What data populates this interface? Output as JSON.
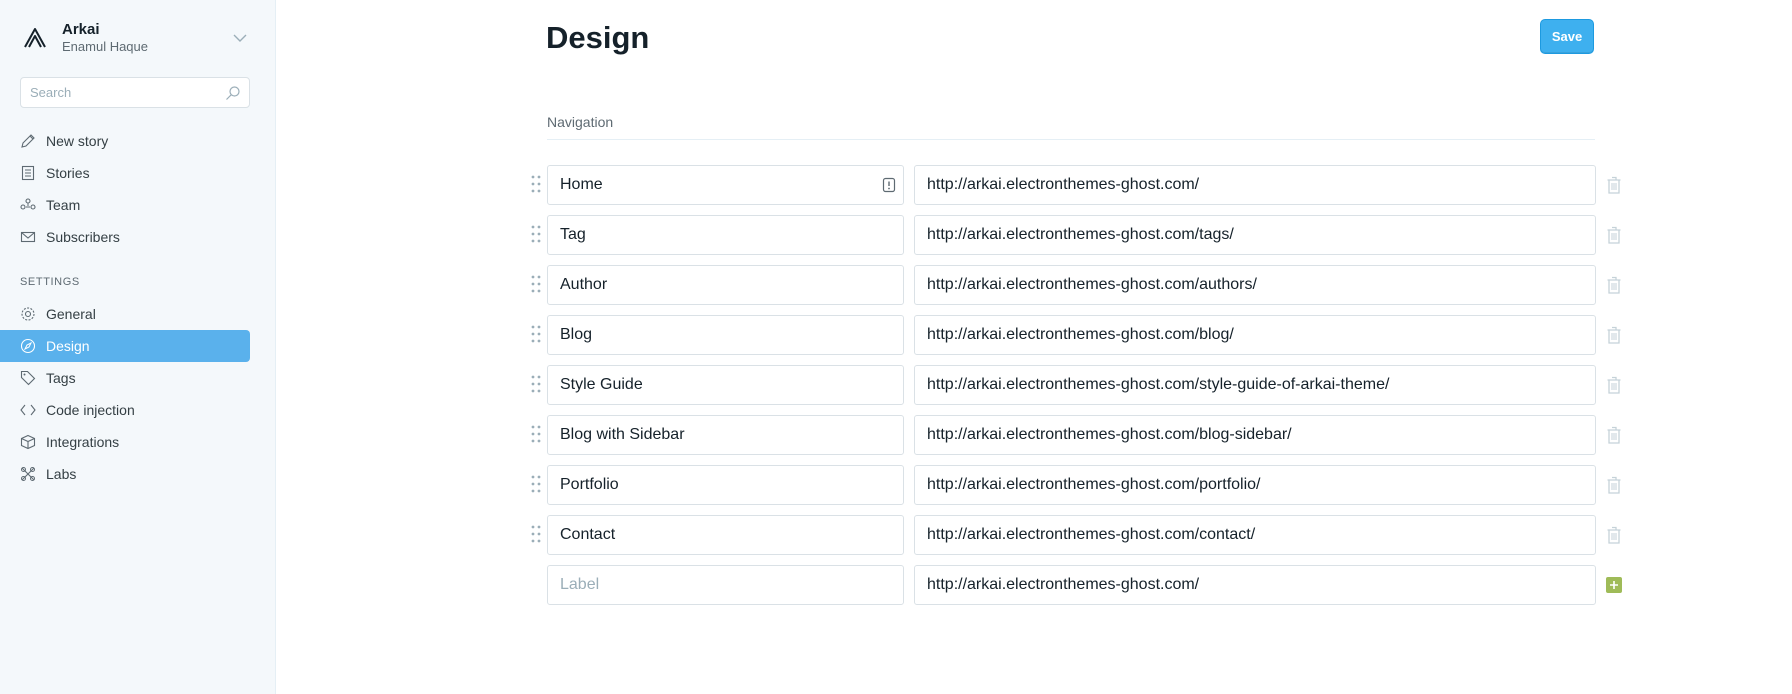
{
  "sidebar": {
    "brand_name": "Arkai",
    "brand_user": "Enamul Haque",
    "search_placeholder": "Search",
    "main_items": [
      {
        "label": "New story"
      },
      {
        "label": "Stories"
      },
      {
        "label": "Team"
      },
      {
        "label": "Subscribers"
      }
    ],
    "settings_label": "SETTINGS",
    "settings_items": [
      {
        "label": "General"
      },
      {
        "label": "Design",
        "active": true
      },
      {
        "label": "Tags"
      },
      {
        "label": "Code injection"
      },
      {
        "label": "Integrations"
      },
      {
        "label": "Labs"
      }
    ]
  },
  "header": {
    "title": "Design",
    "save_label": "Save"
  },
  "navigation": {
    "section_title": "Navigation",
    "items": [
      {
        "label": "Home",
        "url": "http://arkai.electronthemes-ghost.com/"
      },
      {
        "label": "Tag",
        "url": "http://arkai.electronthemes-ghost.com/tags/"
      },
      {
        "label": "Author",
        "url": "http://arkai.electronthemes-ghost.com/authors/"
      },
      {
        "label": "Blog",
        "url": "http://arkai.electronthemes-ghost.com/blog/"
      },
      {
        "label": "Style Guide",
        "url": "http://arkai.electronthemes-ghost.com/style-guide-of-arkai-theme/"
      },
      {
        "label": "Blog with Sidebar",
        "url": "http://arkai.electronthemes-ghost.com/blog-sidebar/"
      },
      {
        "label": "Portfolio",
        "url": "http://arkai.electronthemes-ghost.com/portfolio/"
      },
      {
        "label": "Contact",
        "url": "http://arkai.electronthemes-ghost.com/contact/"
      }
    ],
    "new_item": {
      "label_placeholder": "Label",
      "url": "http://arkai.electronthemes-ghost.com/"
    }
  },
  "colors": {
    "accent": "#3eb0ef",
    "active_nav": "#5ab1ec",
    "add_green": "#9fbb58"
  },
  "icons": {
    "brand": "arkai-logo-icon",
    "new_story": "pen-icon",
    "stories": "document-icon",
    "team": "team-icon",
    "subscribers": "mail-icon",
    "general": "gear-icon",
    "design": "compass-icon",
    "tags": "tag-icon",
    "code_injection": "code-icon",
    "integrations": "box-icon",
    "labs": "beaker-icon"
  }
}
